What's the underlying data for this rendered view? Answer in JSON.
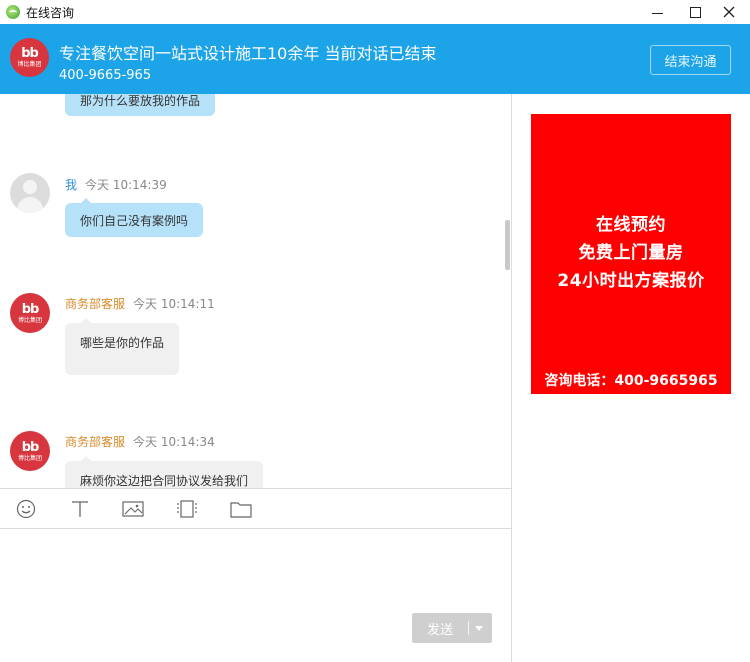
{
  "window": {
    "title": "在线咨询"
  },
  "header": {
    "logo_mark": "bb",
    "logo_sub": "博比集团",
    "title": "专注餐饮空间一站式设计施工10余年 当前对话已结束",
    "phone": "400-9665-965",
    "end_button": "结束沟通"
  },
  "messages": [
    {
      "sender": "",
      "time": "",
      "text": "那为什么要放我的作品",
      "style": "blue"
    },
    {
      "sender": "我",
      "time": "今天 10:14:39",
      "text": "你们自己没有案例吗",
      "style": "blue"
    },
    {
      "sender": "商务部客服",
      "time": "今天 10:14:11",
      "text": "哪些是你的作品",
      "style": "gray"
    },
    {
      "sender": "商务部客服",
      "time": "今天 10:14:34",
      "text": "麻烦你这边把合同协议发给我们",
      "style": "gray"
    }
  ],
  "toolbar": {
    "icons": [
      "emoji-icon",
      "text-format-icon",
      "image-icon",
      "screenshot-icon",
      "folder-icon"
    ]
  },
  "input": {
    "send_label": "发送"
  },
  "ad": {
    "lines": [
      "在线预约",
      "免费上门量房",
      "24小时出方案报价"
    ],
    "phone": "咨询电话：400-9665965",
    "background": "#ff0000"
  },
  "colors": {
    "header": "#1ca3e8",
    "bubble_me": "#b5e2f9",
    "bubble_agent": "#f0f0f0",
    "agent_name": "#d68a2a",
    "my_name": "#2b8fd6"
  }
}
